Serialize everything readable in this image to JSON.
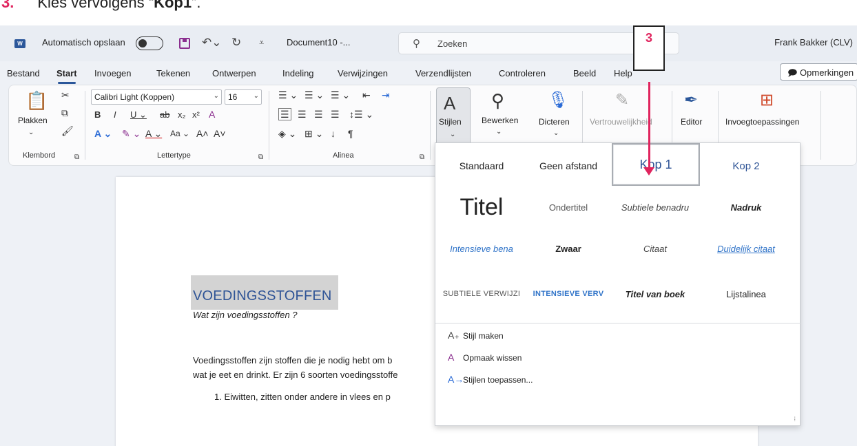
{
  "instruction": {
    "number": "3.",
    "text_before": "Kies vervolgens “",
    "bold": "Kop1",
    "text_after": "”."
  },
  "annotation": {
    "label": "3",
    "color": "#e0245e"
  },
  "titlebar": {
    "app_icon": "W",
    "autosave_label": "Automatisch opslaan",
    "document_title": "Document10  -...",
    "search_placeholder": "Zoeken",
    "user_name": "Frank Bakker (CLV)"
  },
  "tabs": [
    "Bestand",
    "Start",
    "Invoegen",
    "Tekenen",
    "Ontwerpen",
    "Indeling",
    "Verwijzingen",
    "Verzendlijsten",
    "Controleren",
    "Beeld",
    "Help"
  ],
  "active_tab": "Start",
  "comments_label": "Opmerkingen",
  "ribbon": {
    "clipboard": {
      "paste_label": "Plakken",
      "group_label": "Klembord"
    },
    "font": {
      "font_name": "Calibri Light (Koppen)",
      "font_size": "16",
      "group_label": "Lettertype",
      "case_label": "Aa"
    },
    "paragraph": {
      "group_label": "Alinea"
    },
    "styles": {
      "label": "Stijlen"
    },
    "editing": {
      "label": "Bewerken"
    },
    "dictate": {
      "label": "Dicteren"
    },
    "sensitivity": {
      "label": "Vertrouwelijkheid"
    },
    "editor": {
      "label": "Editor"
    },
    "addins": {
      "label": "Invoegtoepassingen"
    }
  },
  "document": {
    "heading": "VOEDINGSSTOFFEN",
    "subheading": "Wat zijn voedingsstoffen ?",
    "paragraph_line1": "Voedingsstoffen zijn stoffen die je nodig hebt om b",
    "paragraph_line2": "wat je eet en drinkt. Er zijn 6 soorten voedingsstoffe",
    "list_item": "1.    Eiwitten, zitten onder andere in vlees en p"
  },
  "styles_gallery": {
    "styles": [
      "Standaard",
      "Geen afstand",
      "Kop 1",
      "Kop 2",
      "Titel",
      "Ondertitel",
      "Subtiele benadru",
      "Nadruk",
      "Intensieve bena",
      "Zwaar",
      "Citaat",
      "Duidelijk citaat",
      "Subtiele verwijzi",
      "Intensieve verv",
      "Titel van boek",
      "Lijstalinea"
    ],
    "selected": "Kop 1",
    "actions": [
      "Stijl maken",
      "Opmaak wissen",
      "Stijlen toepassen..."
    ]
  }
}
